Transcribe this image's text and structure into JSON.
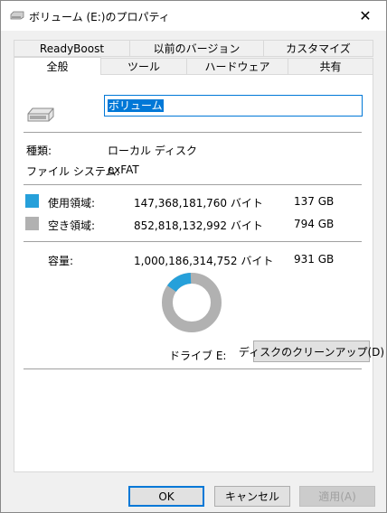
{
  "window": {
    "title": "ボリューム (E:)のプロパティ",
    "close_label": "✕"
  },
  "tabs_row1": [
    "ReadyBoost",
    "以前のバージョン",
    "カスタマイズ"
  ],
  "tabs_row2": [
    "全般",
    "ツール",
    "ハードウェア",
    "共有"
  ],
  "active_tab": "全般",
  "general": {
    "volume_name": "ボリューム",
    "type_label": "種類:",
    "type_value": "ローカル ディスク",
    "fs_label": "ファイル システム:",
    "fs_value": "exFAT",
    "used_label": "使用領域:",
    "used_bytes": "147,368,181,760 バイト",
    "used_size": "137 GB",
    "free_label": "空き領域:",
    "free_bytes": "852,818,132,992 バイト",
    "free_size": "794 GB",
    "capacity_label": "容量:",
    "capacity_bytes": "1,000,186,314,752 バイト",
    "capacity_size": "931 GB",
    "drive_label": "ドライブ E:",
    "cleanup_button": "ディスクのクリーンアップ(D)",
    "used_fraction": 0.147
  },
  "colors": {
    "used": "#26a0da",
    "free": "#b1b1b1",
    "accent": "#0078d7"
  },
  "buttons": {
    "ok": "OK",
    "cancel": "キャンセル",
    "apply": "適用(A)"
  },
  "icons": {
    "drive": "drive-icon",
    "close": "close-icon"
  }
}
